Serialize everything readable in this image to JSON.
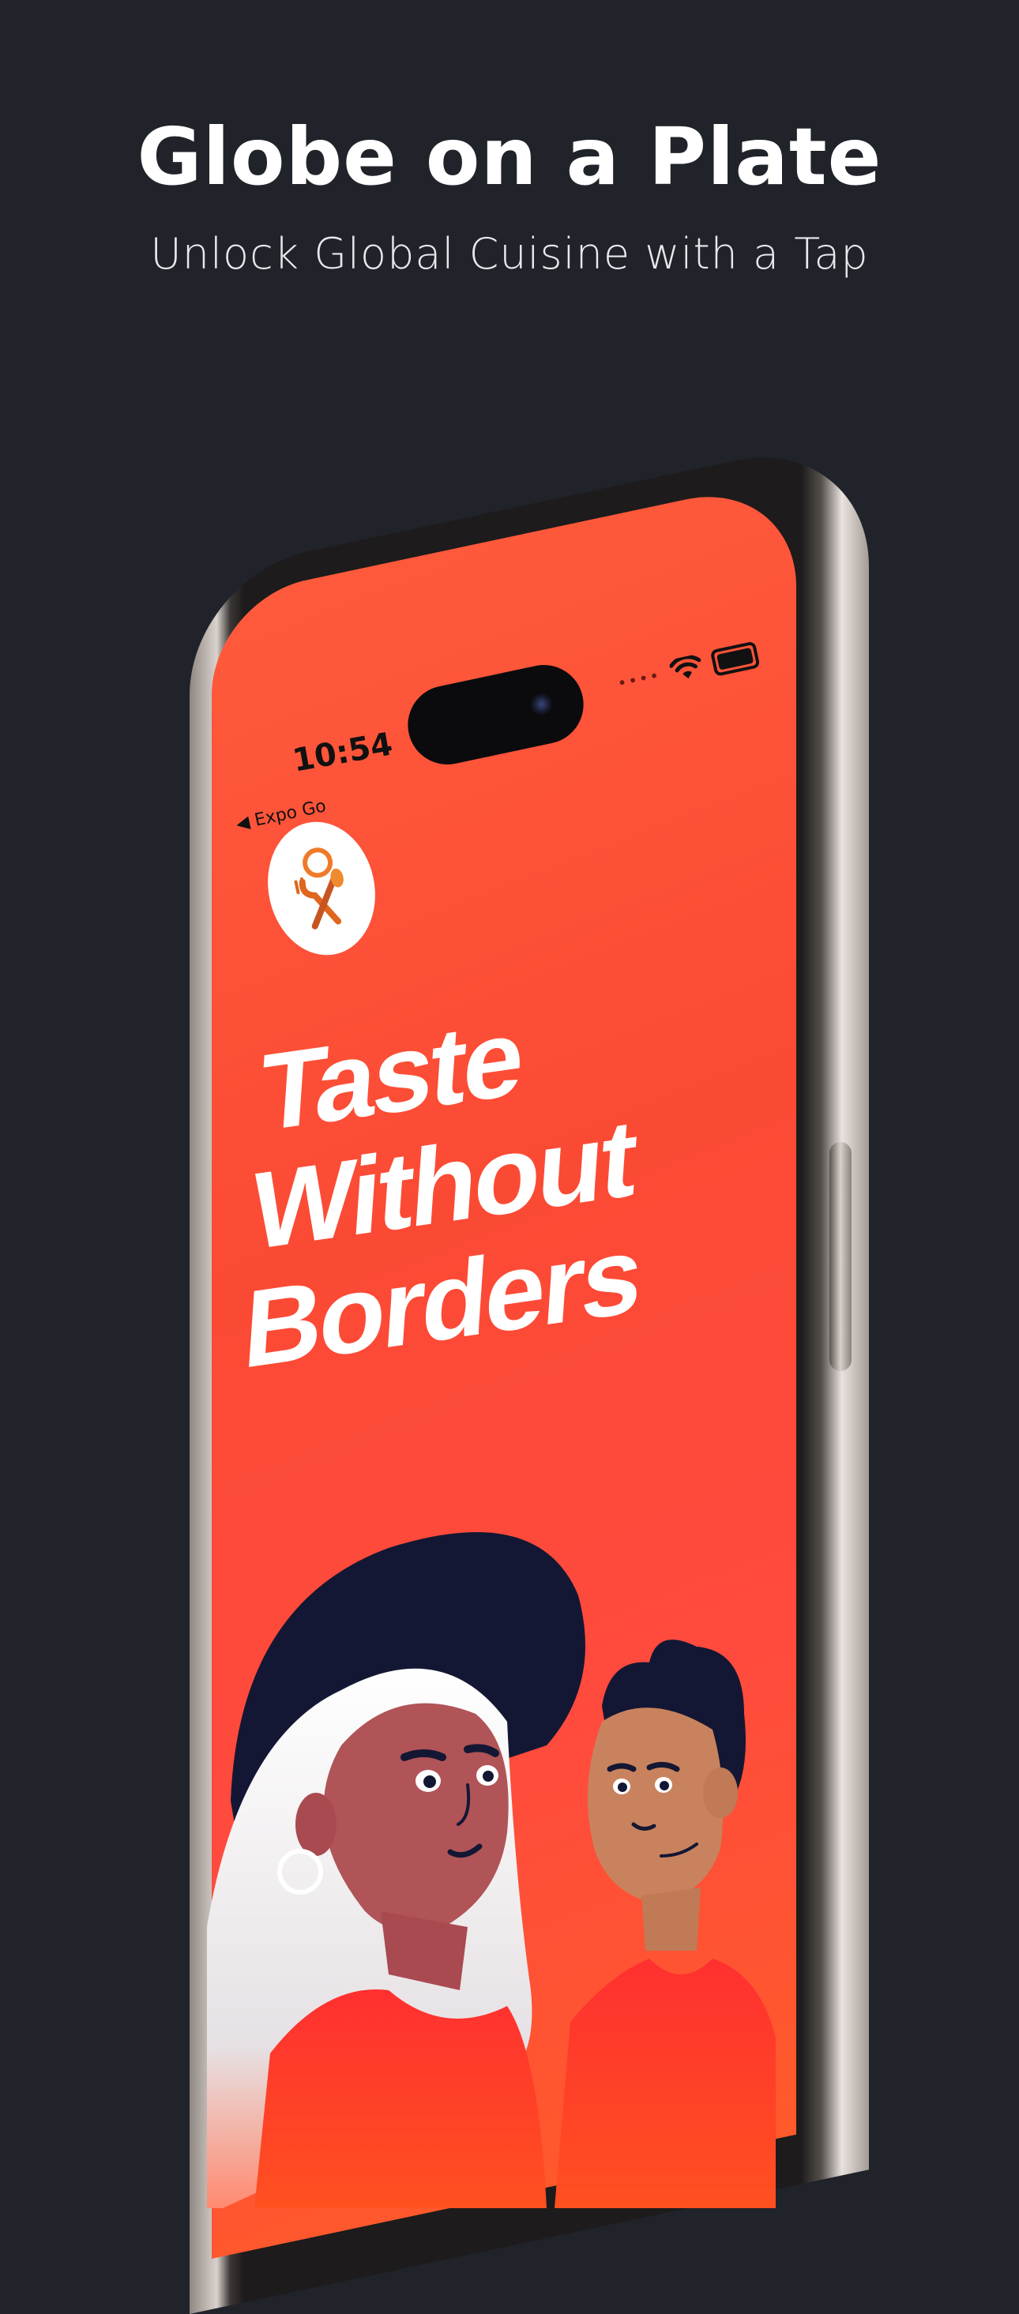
{
  "header": {
    "title": "Globe on a Plate",
    "subtitle": "Unlock Global Cuisine with a Tap"
  },
  "status_bar": {
    "time": "10:54",
    "back_label": "◀ Expo Go",
    "signal_dots": "••••"
  },
  "app_screen": {
    "hero_lines": [
      "Taste",
      "Without",
      "Borders"
    ],
    "logo_icon": "fork-and-spoon-icon"
  },
  "colors": {
    "background": "#20232a",
    "accent": "#ff4a3a",
    "hero_text": "#ffffff"
  }
}
